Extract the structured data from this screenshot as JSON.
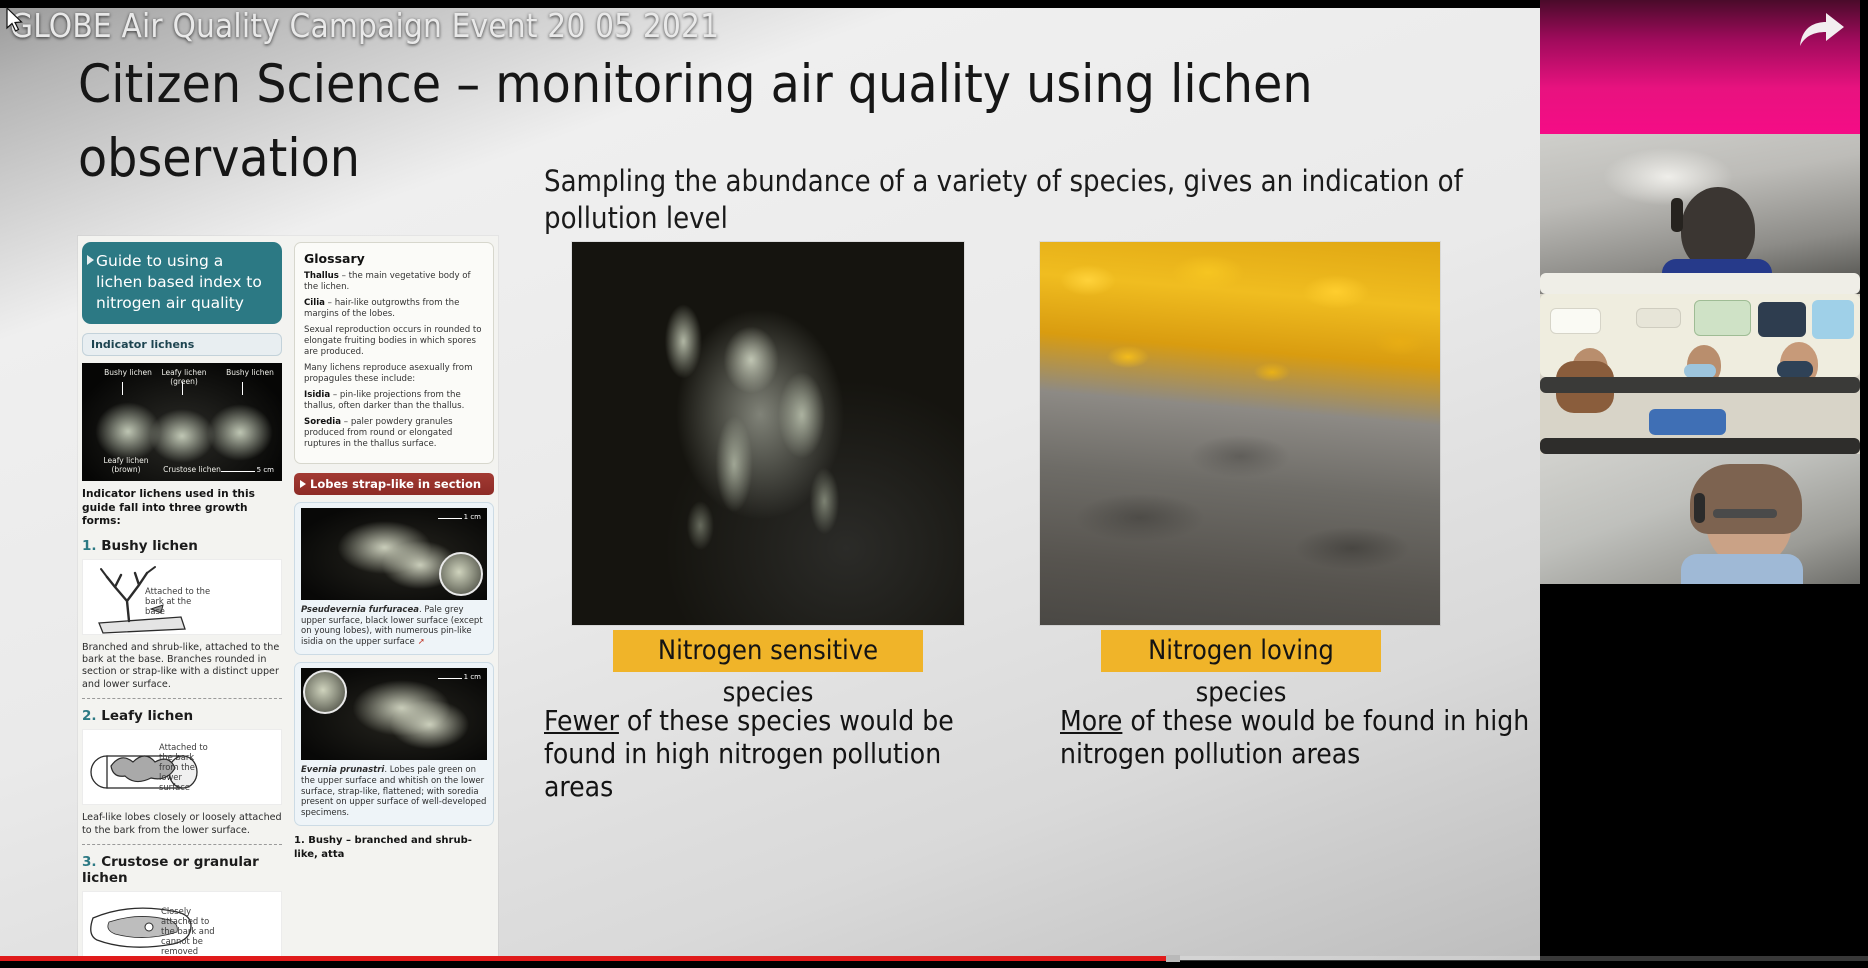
{
  "video": {
    "title": "GLOBE Air Quality Campaign Event 20 05 2021",
    "share_icon": "share-arrow-icon",
    "cursor_icon": "mouse-cursor"
  },
  "slide": {
    "title_line1": "Citizen Science – monitoring air quality using lichen",
    "title_line2": "observation",
    "lead_line1": "Sampling the abundance of a variety of species, gives an indication of",
    "lead_line2": "pollution level",
    "caption_sensitive": "Nitrogen sensitive species",
    "caption_loving": "Nitrogen loving species",
    "footnote_left_emph": "Fewer",
    "footnote_left_rest": " of these species would be found in high nitrogen pollution areas",
    "footnote_right_emph": "More",
    "footnote_right_rest": " of these would be found in high nitrogen pollution areas"
  },
  "guide": {
    "hero_title": "Guide to using a lichen based index to nitrogen air quality",
    "pill_indicator": "Indicator lichens",
    "photo_labels": {
      "bushy_left": "Bushy lichen",
      "leafy": "Leafy lichen (green)",
      "bushy_right": "Bushy lichen",
      "leafy_brown": "Leafy lichen (brown)",
      "crustose": "Crustose lichen",
      "scale": "5 cm"
    },
    "intro": "Indicator lichens used in this guide fall into three growth forms:",
    "form1_head_num": "1.",
    "form1_head": "Bushy lichen",
    "form1_sketch_caption": "Attached to the bark at the base",
    "form1_body": "Branched and shrub-like, attached to the bark at the base. Branches rounded in section or strap-like with a distinct upper and lower surface.",
    "form2_head_num": "2.",
    "form2_head": "Leafy lichen",
    "form2_sketch_caption": "Attached to the bark from the lower surface",
    "form2_body": "Leaf-like lobes closely or loosely attached to the bark from the lower surface.",
    "form3_head_num": "3.",
    "form3_head": "Crustose or granular lichen",
    "form3_sketch_caption": "Closely attached to the bark and cannot be removed without",
    "glossary_title": "Glossary",
    "glossary_thallus_term": "Thallus",
    "glossary_thallus_def": " – the main vegetative body of the lichen.",
    "glossary_cilia_term": "Cilia",
    "glossary_cilia_def": " – hair-like outgrowths from the margins of the lobes.",
    "glossary_sexual": "Sexual reproduction occurs in rounded to elongate fruiting bodies in which spores are produced.",
    "glossary_asexual": "Many lichens reproduce asexually from propagules these include:",
    "glossary_isidia_term": "Isidia",
    "glossary_isidia_def": " – pin-like projections from the thallus, often darker than the thallus.",
    "glossary_soredia_term": "Soredia",
    "glossary_soredia_def": " – paler powdery granules produced from round or elongated ruptures in the thallus surface.",
    "banner_lobes": "Lobes strap-like in section",
    "spec1_name": "Pseudevernia furfuracea",
    "spec1_desc": ". Pale grey upper surface, black lower surface (except on young lobes), with numerous pin-like isidia on the upper surface",
    "spec2_name": "Evernia prunastri",
    "spec2_desc": ". Lobes pale green on the upper surface and whitish on the lower surface, strap-like, flattened; with soredia present on upper surface of well-developed specimens.",
    "scale_1cm": "1 cm",
    "bottom_key": "1. Bushy – branched and shrub-like, atta"
  },
  "colors": {
    "teal": "#2c7984",
    "amber": "#f0b429",
    "progress_red": "#e01b1b",
    "pink": "#e8127f",
    "banner_red": "#a33a33"
  },
  "player": {
    "progress_percent": 62
  }
}
